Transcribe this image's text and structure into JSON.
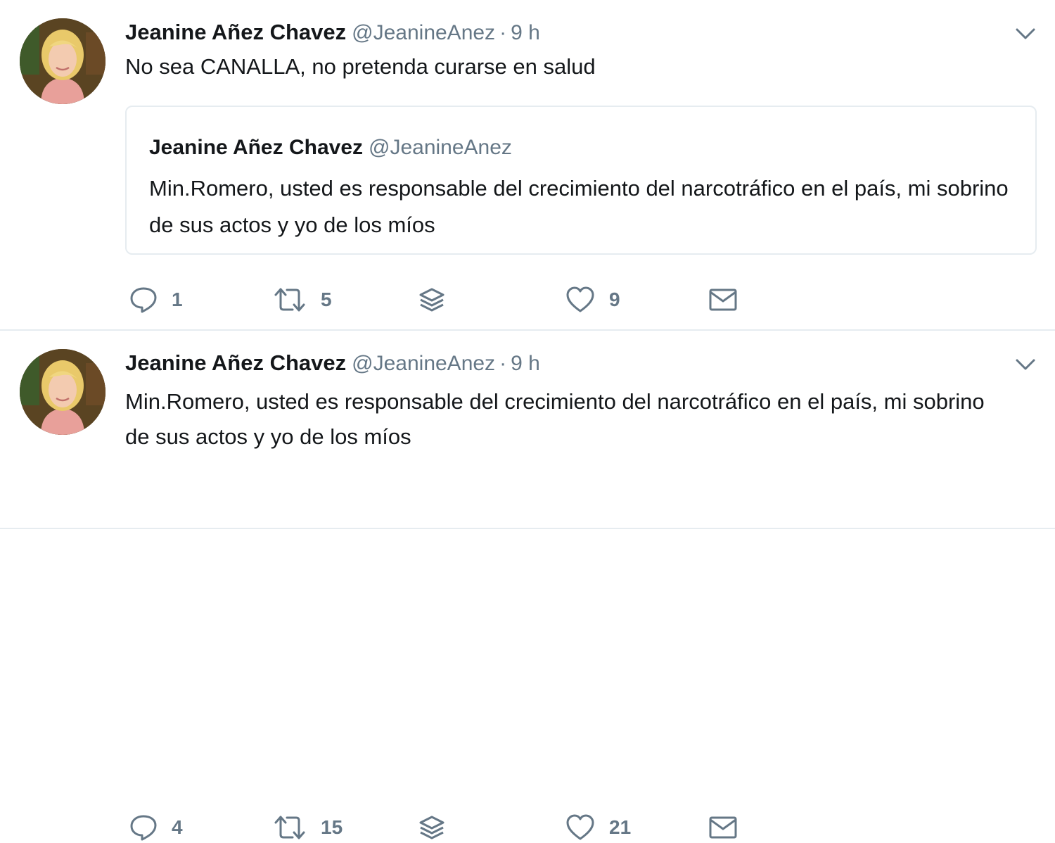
{
  "tweets": [
    {
      "author_name": "Jeanine Añez Chavez",
      "author_handle": "@JeanineAnez",
      "separator": "·",
      "time": "9 h",
      "text": "No sea CANALLA, no pretenda curarse en salud",
      "quoted_tweet": {
        "author_name": "Jeanine Añez Chavez",
        "author_handle": "@JeanineAnez",
        "text": "Min.Romero, usted es responsable del crecimiento del narcotráfico en el país, mi sobrino de sus actos y yo de los míos"
      },
      "actions": {
        "replies": "1",
        "retweets": "5",
        "likes": "9"
      }
    },
    {
      "author_name": "Jeanine Añez Chavez",
      "author_handle": "@JeanineAnez",
      "separator": "·",
      "time": "9 h",
      "text": "Min.Romero, usted es responsable del crecimiento del narcotráfico en el país, mi sobrino de sus actos y yo de los míos",
      "actions": {
        "replies": "4",
        "retweets": "15",
        "likes": "21"
      }
    }
  ],
  "icons": {
    "reply": "speech-bubble-icon",
    "retweet": "retweet-icon",
    "layers": "layers-icon",
    "like": "heart-icon",
    "message": "envelope-icon",
    "menu": "chevron-down-icon"
  },
  "colors": {
    "text": "#14171a",
    "secondary": "#657786",
    "border": "#e6ecf0"
  }
}
